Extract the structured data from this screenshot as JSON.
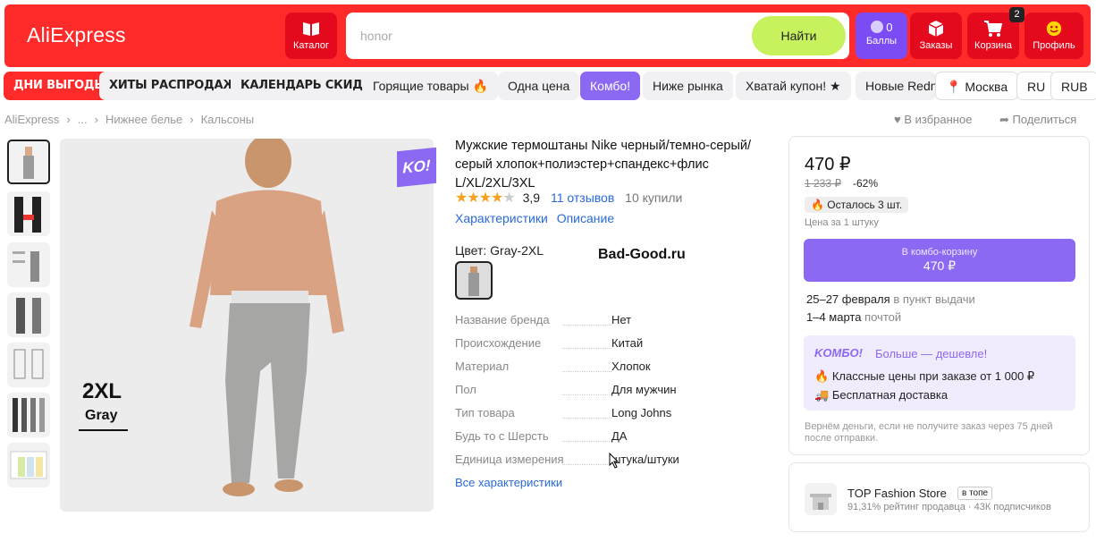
{
  "header": {
    "logo": "AliExpress",
    "catalog_label": "Каталог",
    "search_placeholder": "honor",
    "search_button": "Найти",
    "points_value": "0",
    "points_label": "Баллы",
    "orders_label": "Заказы",
    "cart_label": "Корзина",
    "cart_count": "2",
    "profile_label": "Профиль"
  },
  "nav": {
    "chips": [
      "ДНИ ВЫГОДЫ",
      "ХИТЫ РАСПРОДАЖИ",
      "КАЛЕНДАРЬ СКИДОК",
      "Горящие товары 🔥",
      "Одна цена",
      "Комбо!",
      "Ниже рынка",
      "Хватай купон! ★",
      "Новые Redn"
    ],
    "city": "Москва",
    "lang": "RU",
    "currency": "RUB"
  },
  "breadcrumbs": [
    "AliExpress",
    "...",
    "Нижнее белье",
    "Кальсоны"
  ],
  "actions": {
    "favorite": "В избранное",
    "share": "Поделиться"
  },
  "image": {
    "size": "2XL",
    "color": "Gray",
    "ko_badge": "KO!"
  },
  "product": {
    "title": "Мужские термоштаны Nike черный/темно-серый/серый хлопок+полиэстер+спандекс+флис L/XL/2XL/3XL",
    "rating": "3,9",
    "reviews": "11 отзывов",
    "sold": "10 купили",
    "rating_stars": 3.9,
    "tabs": [
      "Характеристики",
      "Описание"
    ],
    "color_label": "Цвет: Gray-2XL",
    "watermark": "Bad-Good.ru",
    "specs": [
      {
        "k": "Название бренда",
        "v": "Нет"
      },
      {
        "k": "Происхождение",
        "v": "Китай"
      },
      {
        "k": "Материал",
        "v": "Хлопок"
      },
      {
        "k": "Пол",
        "v": "Для мужчин"
      },
      {
        "k": "Тип товара",
        "v": "Long Johns"
      },
      {
        "k": "Будь то с Шерсть",
        "v": "ДА"
      },
      {
        "k": "Единица измерения",
        "v": "штука/штуки"
      }
    ],
    "all_specs": "Все характеристики"
  },
  "buy": {
    "price": "470 ₽",
    "old_price": "1 233 ₽",
    "discount": "-62%",
    "stock": "🔥 Осталось 3 шт.",
    "unit": "Цена за 1 штуку",
    "combo_button_top": "В комбо-корзину",
    "combo_button_price": "470 ₽",
    "delivery1_date": "25–27 февраля",
    "delivery1_type": "в пункт выдачи",
    "delivery2_date": "1–4 марта",
    "delivery2_type": "почтой",
    "combo_logo": "KOMБO!",
    "combo_more": "Больше — дешевле!",
    "combo_line1": "Классные цены при заказе от 1 000 ₽",
    "combo_line2": "Бесплатная доставка",
    "refund": "Вернём деньги, если не получите заказ через 75 дней после отправки."
  },
  "store": {
    "name": "TOP Fashion Store",
    "badge": "в топе",
    "meta": "91,31% рейтинг продавца · 43К подписчиков"
  },
  "colors": {
    "brand_red": "#ff2a2a",
    "combo_purple": "#8b69f2",
    "search_green": "#c7f25e",
    "link_blue": "#2a6ad8"
  }
}
